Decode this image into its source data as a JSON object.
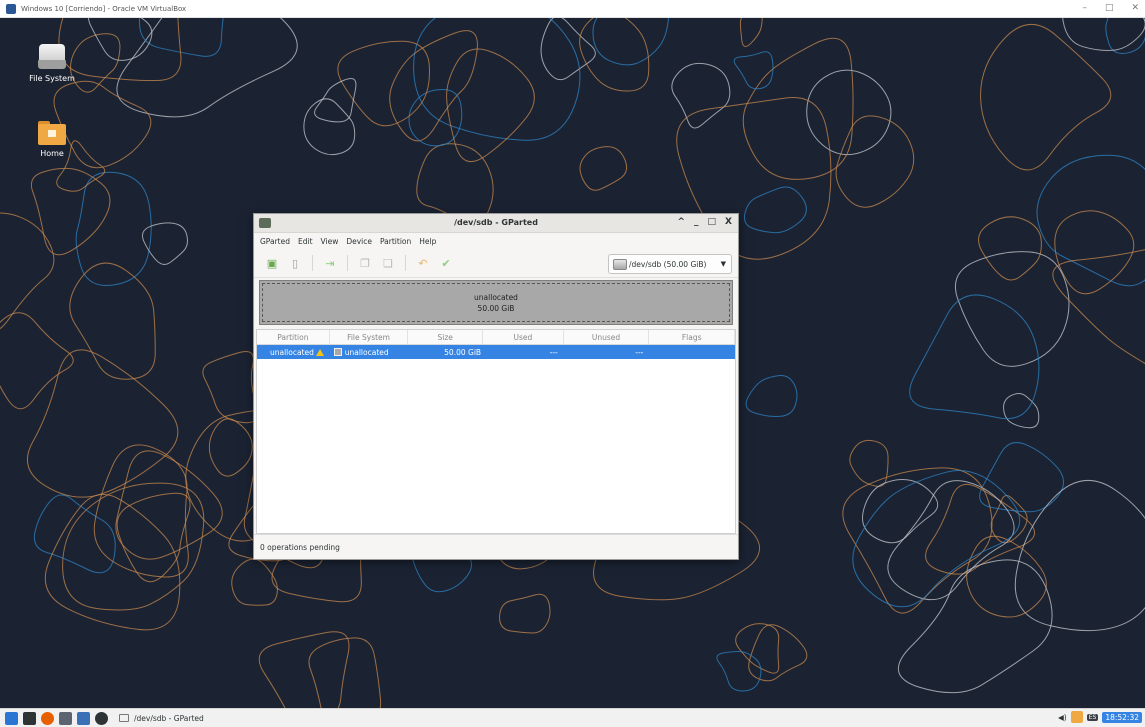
{
  "host": {
    "title": "Windows 10 [Corriendo] - Oracle VM VirtualBox",
    "controls": [
      "–",
      "□",
      "✕"
    ]
  },
  "desktop": {
    "icons": [
      {
        "label": "File System",
        "icon": "drive-icon"
      },
      {
        "label": "Home",
        "icon": "home-folder-icon"
      }
    ]
  },
  "window": {
    "title": "/dev/sdb - GParted",
    "controls": {
      "up": "^",
      "minimize": "_",
      "maximize": "□",
      "close": "X"
    },
    "menu": [
      "GParted",
      "Edit",
      "View",
      "Device",
      "Partition",
      "Help"
    ],
    "toolbar": [
      {
        "name": "new-partition",
        "glyph": "▣",
        "color": "#6aa84f"
      },
      {
        "name": "delete-partition",
        "glyph": "▯",
        "color": "#9a9a9a"
      },
      {
        "name": "resize-move",
        "glyph": "⇥",
        "color": "#8ccf7e"
      },
      {
        "name": "copy",
        "glyph": "❐",
        "color": "#b8b8b8"
      },
      {
        "name": "paste",
        "glyph": "❏",
        "color": "#b8b8b8"
      },
      {
        "name": "undo",
        "glyph": "↶",
        "color": "#e8b76a"
      },
      {
        "name": "apply",
        "glyph": "✔",
        "color": "#8ccf7e"
      }
    ],
    "device": "/dev/sdb (50.00 GiB)",
    "disk_map": {
      "name": "unallocated",
      "size": "50.00 GiB"
    },
    "columns": [
      "Partition",
      "File System",
      "Size",
      "Used",
      "Unused",
      "Flags"
    ],
    "rows": [
      {
        "partition": "unallocated",
        "filesystem": "unallocated",
        "size": "50.00 GiB",
        "used": "---",
        "unused": "---",
        "flags": ""
      }
    ],
    "status": "0 operations pending"
  },
  "taskbar": {
    "launchers": [
      {
        "name": "start-menu",
        "color": "#2a76d2"
      },
      {
        "name": "terminal",
        "color": "#2e3436"
      },
      {
        "name": "firefox",
        "color": "#e66000"
      },
      {
        "name": "file-manager",
        "color": "#5b6470"
      },
      {
        "name": "text-editor",
        "color": "#3b6fb6"
      },
      {
        "name": "settings",
        "color": "#2e3436"
      }
    ],
    "active_task": "/dev/sdb - GParted",
    "clock": "18:52:32",
    "keyboard": "ES"
  },
  "colors": {
    "selection": "#3584e4",
    "wallpaper_bg": "#1b2333",
    "contour_orange": "#c98a4d",
    "contour_blue": "#2f86c8",
    "contour_white": "#c8ccd2"
  }
}
